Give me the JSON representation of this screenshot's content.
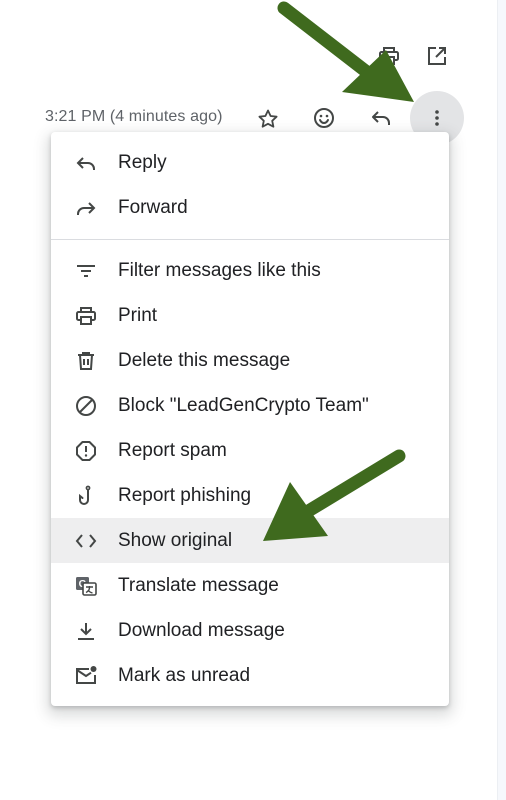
{
  "header": {
    "timestamp": "3:21 PM (4 minutes ago)",
    "icons": [
      "print-icon",
      "open-in-new-window-icon",
      "star-icon",
      "emoji-reaction-icon",
      "reply-icon",
      "more-vert-icon"
    ]
  },
  "menu": {
    "items": [
      {
        "label": "Reply",
        "icon": "reply-icon"
      },
      {
        "label": "Forward",
        "icon": "forward-icon"
      },
      {
        "label": "Filter messages like this",
        "icon": "filter-icon"
      },
      {
        "label": "Print",
        "icon": "print-icon"
      },
      {
        "label": "Delete this message",
        "icon": "trash-icon"
      },
      {
        "label": "Block \"LeadGenCrypto Team\"",
        "icon": "block-icon"
      },
      {
        "label": "Report spam",
        "icon": "report-spam-icon"
      },
      {
        "label": "Report phishing",
        "icon": "phishing-hook-icon"
      },
      {
        "label": "Show original",
        "icon": "code-icon",
        "highlighted": true
      },
      {
        "label": "Translate message",
        "icon": "translate-icon"
      },
      {
        "label": "Download message",
        "icon": "download-icon"
      },
      {
        "label": "Mark as unread",
        "icon": "mark-unread-icon"
      }
    ]
  },
  "annotations": {
    "arrow_color": "#3f6a1e",
    "arrows": [
      "arrow-to-more-options",
      "arrow-to-show-original"
    ]
  },
  "colors": {
    "highlight": "#eeeeef",
    "more_button_bg": "#e3e4e6",
    "icon": "#444746",
    "text": "#202124",
    "timestamp": "#5f6368"
  }
}
